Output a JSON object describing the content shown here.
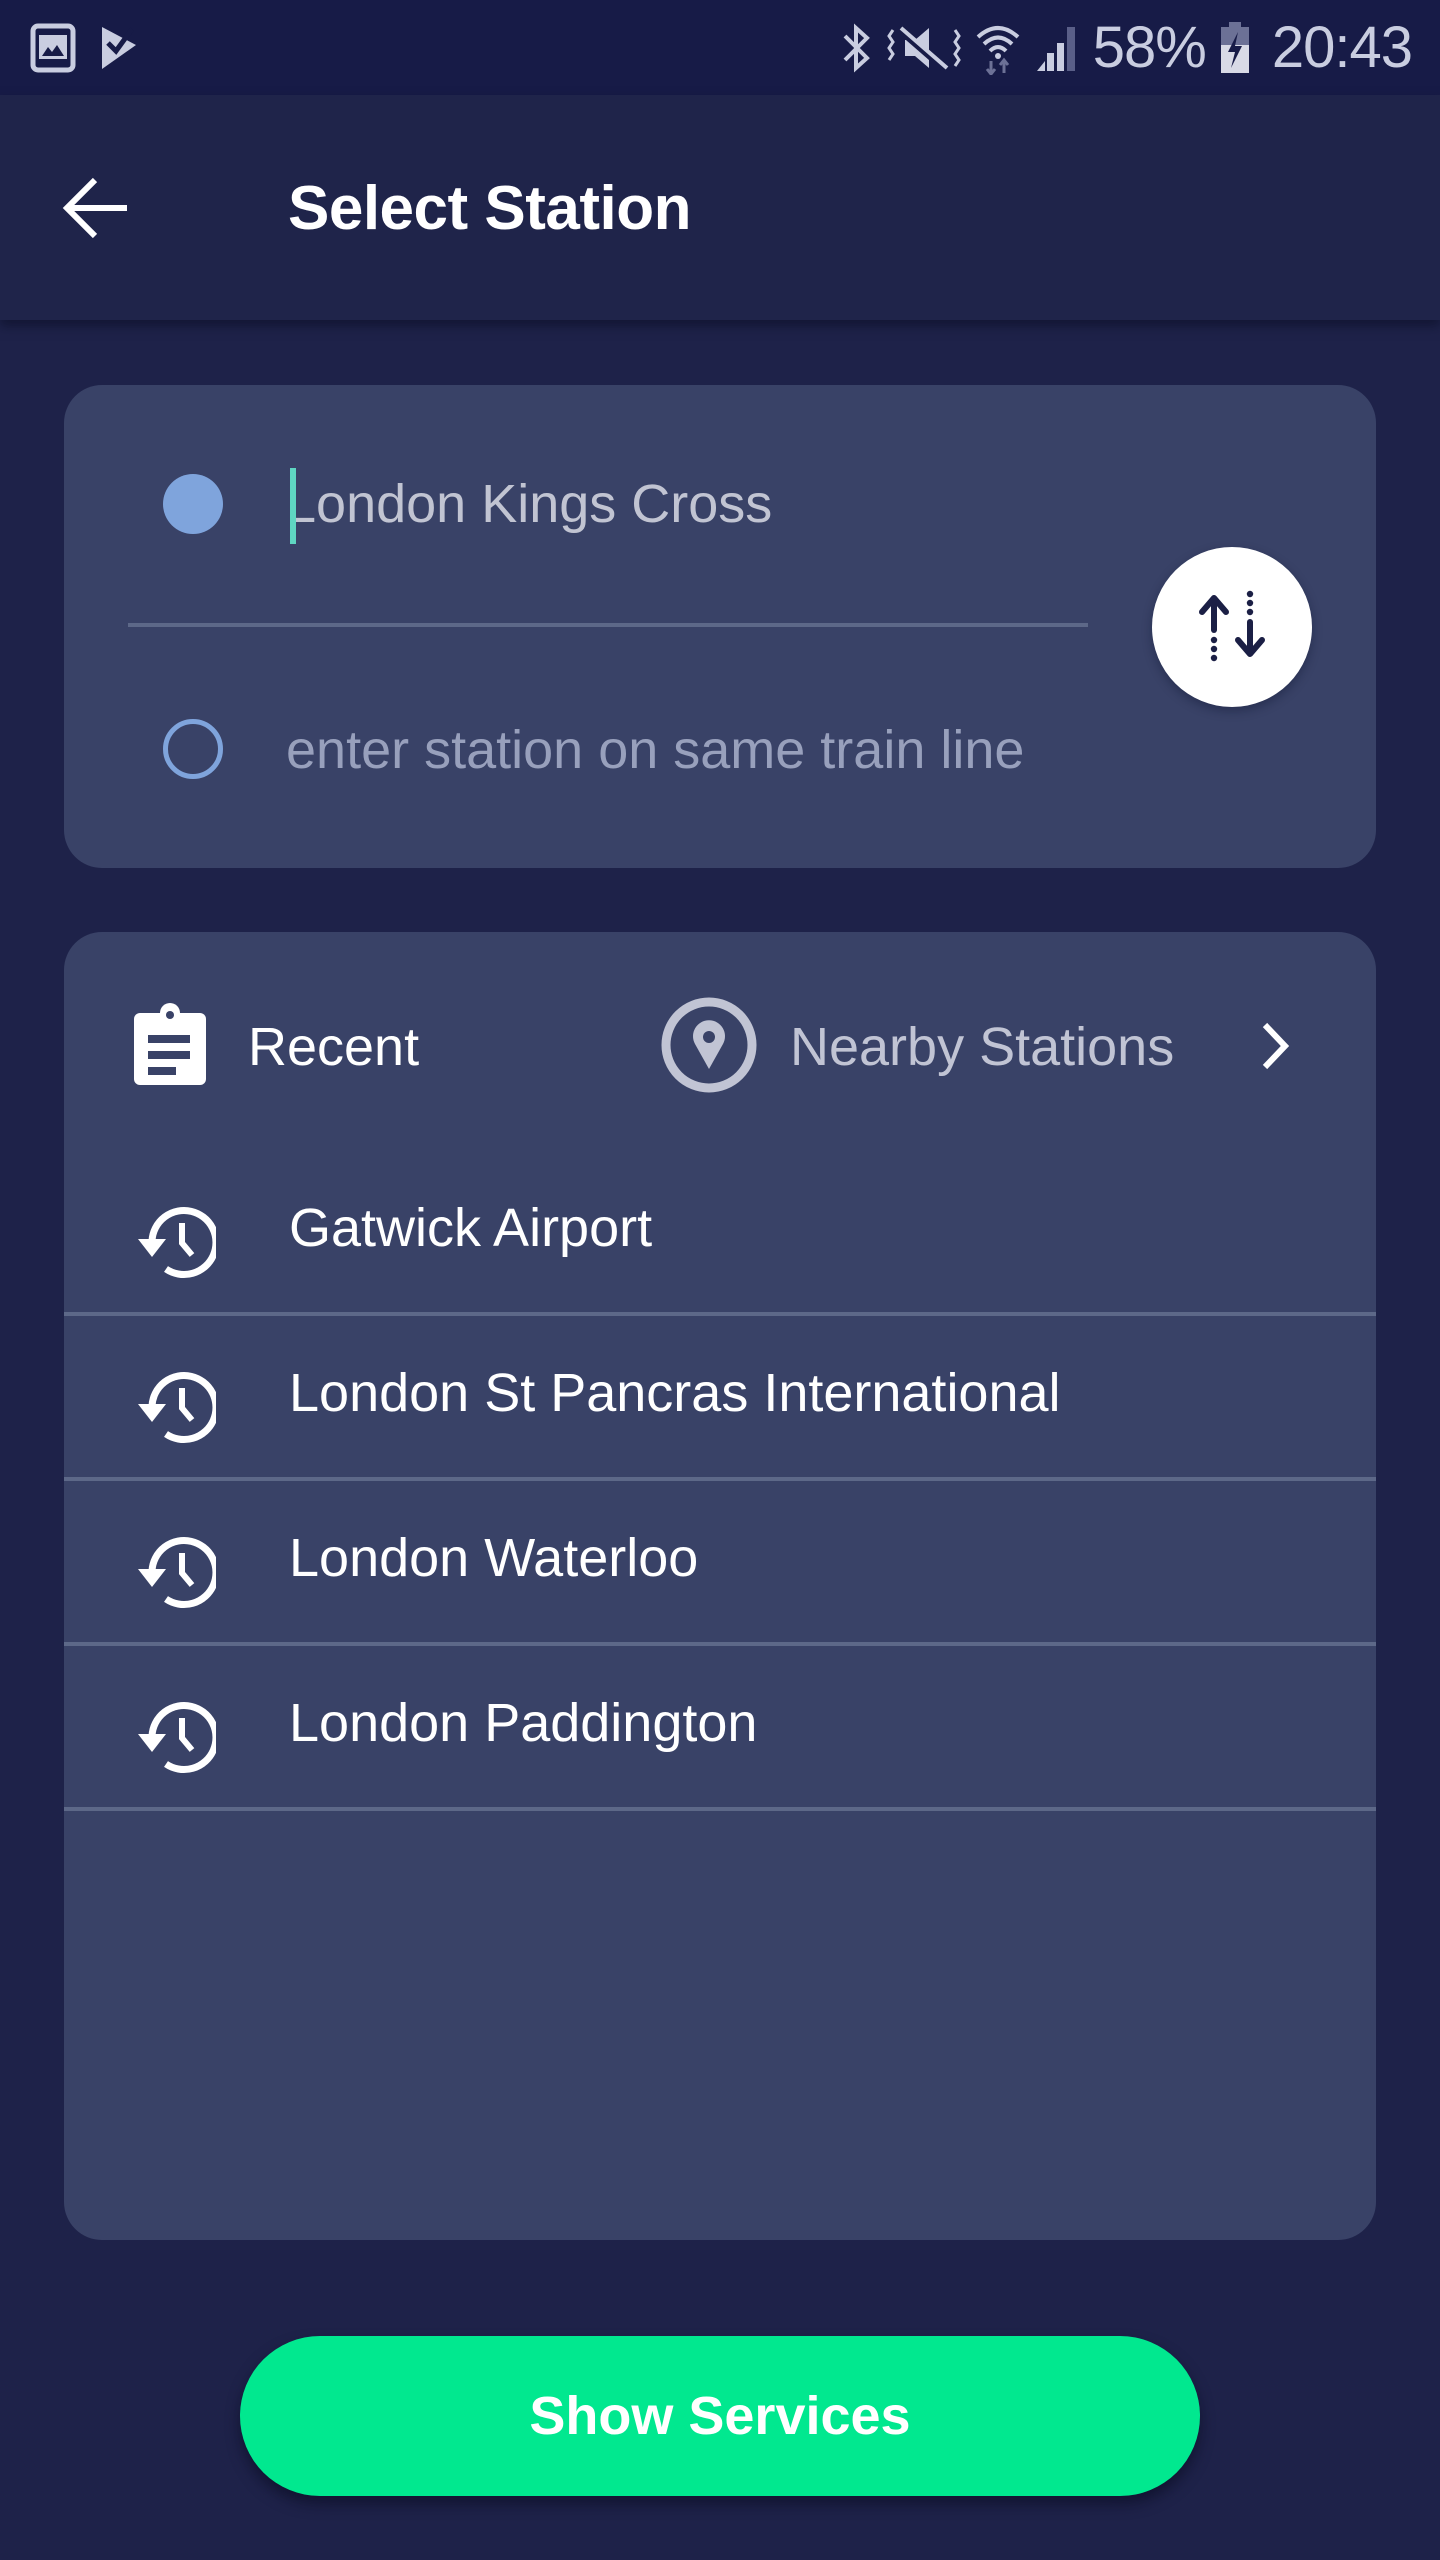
{
  "status_bar": {
    "left_icons": [
      "gallery-icon",
      "task-check-icon"
    ],
    "right_icons": [
      "bluetooth-icon",
      "mute-vibrate-icon",
      "wifi-icon",
      "signal-icon"
    ],
    "battery_percent": "58%",
    "battery_icon": "battery-charging-icon",
    "time": "20:43"
  },
  "app_bar": {
    "back_icon": "arrow-left-icon",
    "title": "Select Station"
  },
  "route": {
    "from": {
      "value": "",
      "placeholder": "London Kings Cross",
      "focused": true
    },
    "to": {
      "value": "",
      "placeholder": "enter station on same train line"
    },
    "swap_icon": "swap-vertical-icon"
  },
  "tabs": [
    {
      "label": "Recent",
      "icon": "clipboard-icon",
      "active": true
    },
    {
      "label": "Nearby Stations",
      "icon": "location-pin-icon",
      "active": false
    }
  ],
  "tabs_chevron_icon": "chevron-right-icon",
  "recent_stations": [
    {
      "name": "Gatwick Airport",
      "icon": "history-icon"
    },
    {
      "name": "London St Pancras International",
      "icon": "history-icon"
    },
    {
      "name": "London Waterloo",
      "icon": "history-icon"
    },
    {
      "name": "London Paddington",
      "icon": "history-icon"
    }
  ],
  "actions": {
    "show_services_label": "Show Services"
  },
  "colors": {
    "background": "#1e2249",
    "status_bar": "#171b47",
    "app_bar": "#1f244a",
    "card": "#394267",
    "divider": "#5d6888",
    "accent_dot": "#7fa4dc",
    "primary_button": "#01e88f",
    "caret": "#5fd6c2"
  }
}
